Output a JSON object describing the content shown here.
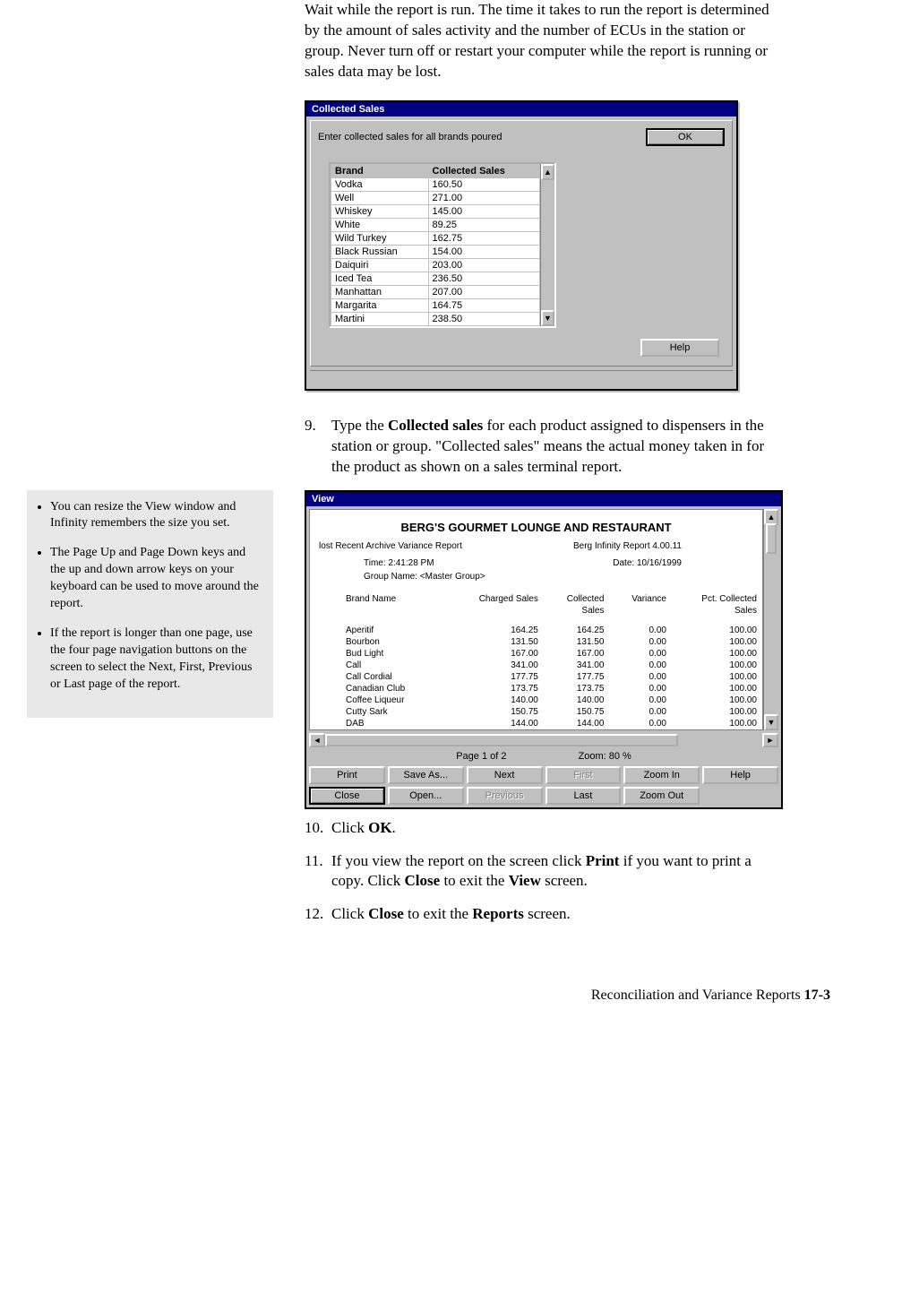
{
  "intro": "Wait while the report is run. The time it takes to run the report is determined by the amount of sales activity and the number of ECUs in the station or group. Never turn off or restart your computer while the report is running or sales data may be lost.",
  "cs": {
    "title": "Collected Sales",
    "instr": "Enter collected sales for all brands poured",
    "ok": "OK",
    "help": "Help",
    "col_brand": "Brand",
    "col_cs": "Collected Sales",
    "rows": [
      {
        "brand": "Vodka",
        "val": "160.50"
      },
      {
        "brand": "Well",
        "val": "271.00"
      },
      {
        "brand": "Whiskey",
        "val": "145.00"
      },
      {
        "brand": "White",
        "val": "89.25"
      },
      {
        "brand": "Wild Turkey",
        "val": "162.75"
      },
      {
        "brand": "Black Russian",
        "val": "154.00"
      },
      {
        "brand": "Daiquiri",
        "val": "203.00"
      },
      {
        "brand": "Iced Tea",
        "val": "236.50"
      },
      {
        "brand": "Manhattan",
        "val": "207.00"
      },
      {
        "brand": "Margarita",
        "val": "164.75"
      },
      {
        "brand": "Martini",
        "val": "238.50"
      }
    ]
  },
  "step9_num": "9.",
  "step9_a": "Type the ",
  "step9_b": "Collected sales",
  "step9_c": " for each product assigned to dispensers in the station or group. \"Collected sales\" means the actual money taken in for the product as shown on a sales terminal report.",
  "side": {
    "n1": "You can resize the View window and Infinity remembers the size you set.",
    "n2": "The Page Up and Page Down keys and the up and down arrow keys on your keyboard can be used to move around the report.",
    "n3": "If the report is longer than one page, use the four page navigation buttons on the screen to select the Next, First, Previous or Last page of the report."
  },
  "view": {
    "title": "View",
    "heading": "BERG'S GOURMET LOUNGE AND RESTAURANT",
    "sub_a": "lost Recent Archive Variance Report",
    "sub_b": "Berg Infinity Report 4.00.11",
    "time": "Time: 2:41:28 PM",
    "date": "Date: 10/16/1999",
    "group": "Group Name: <Master Group>",
    "h_brand": "Brand Name",
    "h_charged": "Charged Sales",
    "h_collected": "Collected",
    "h_collected2": "Sales",
    "h_var": "Variance",
    "h_pct": "Pct. Collected",
    "h_pct2": "Sales",
    "rows": [
      {
        "n": "Aperitif",
        "a": "164.25",
        "b": "164.25",
        "c": "0.00",
        "d": "100.00"
      },
      {
        "n": "Bourbon",
        "a": "131.50",
        "b": "131.50",
        "c": "0.00",
        "d": "100.00"
      },
      {
        "n": "Bud Light",
        "a": "167.00",
        "b": "167.00",
        "c": "0.00",
        "d": "100.00"
      },
      {
        "n": "Call",
        "a": "341.00",
        "b": "341.00",
        "c": "0.00",
        "d": "100.00"
      },
      {
        "n": "Call Cordial",
        "a": "177.75",
        "b": "177.75",
        "c": "0.00",
        "d": "100.00"
      },
      {
        "n": "Canadian Club",
        "a": "173.75",
        "b": "173.75",
        "c": "0.00",
        "d": "100.00"
      },
      {
        "n": "Coffee Liqueur",
        "a": "140.00",
        "b": "140.00",
        "c": "0.00",
        "d": "100.00"
      },
      {
        "n": "Cutty Sark",
        "a": "150.75",
        "b": "150.75",
        "c": "0.00",
        "d": "100.00"
      },
      {
        "n": "DAB",
        "a": "144.00",
        "b": "144.00",
        "c": "0.00",
        "d": "100.00"
      }
    ],
    "page": "Page 1 of 2",
    "zoom": "Zoom: 80 %",
    "btn_print": "Print",
    "btn_saveas": "Save As...",
    "btn_next": "Next",
    "btn_first": "First",
    "btn_zoomin": "Zoom In",
    "btn_help": "Help",
    "btn_close": "Close",
    "btn_open": "Open...",
    "btn_prev": "Previous",
    "btn_last": "Last",
    "btn_zoomout": "Zoom Out"
  },
  "step10_num": "10.",
  "step10_a": "Click ",
  "step10_b": "OK",
  "step10_c": ".",
  "step11_num": "11.",
  "step11_a": "If you view the report on the screen click ",
  "step11_b": "Print",
  "step11_c": " if you want to print a copy. Click ",
  "step11_d": "Close",
  "step11_e": " to exit the ",
  "step11_f": "View",
  "step11_g": " screen.",
  "step12_num": "12.",
  "step12_a": "Click ",
  "step12_b": "Close",
  "step12_c": " to exit the ",
  "step12_d": "Reports",
  "step12_e": " screen.",
  "footer_a": "Reconciliation and Variance Reports  ",
  "footer_b": "17-3"
}
